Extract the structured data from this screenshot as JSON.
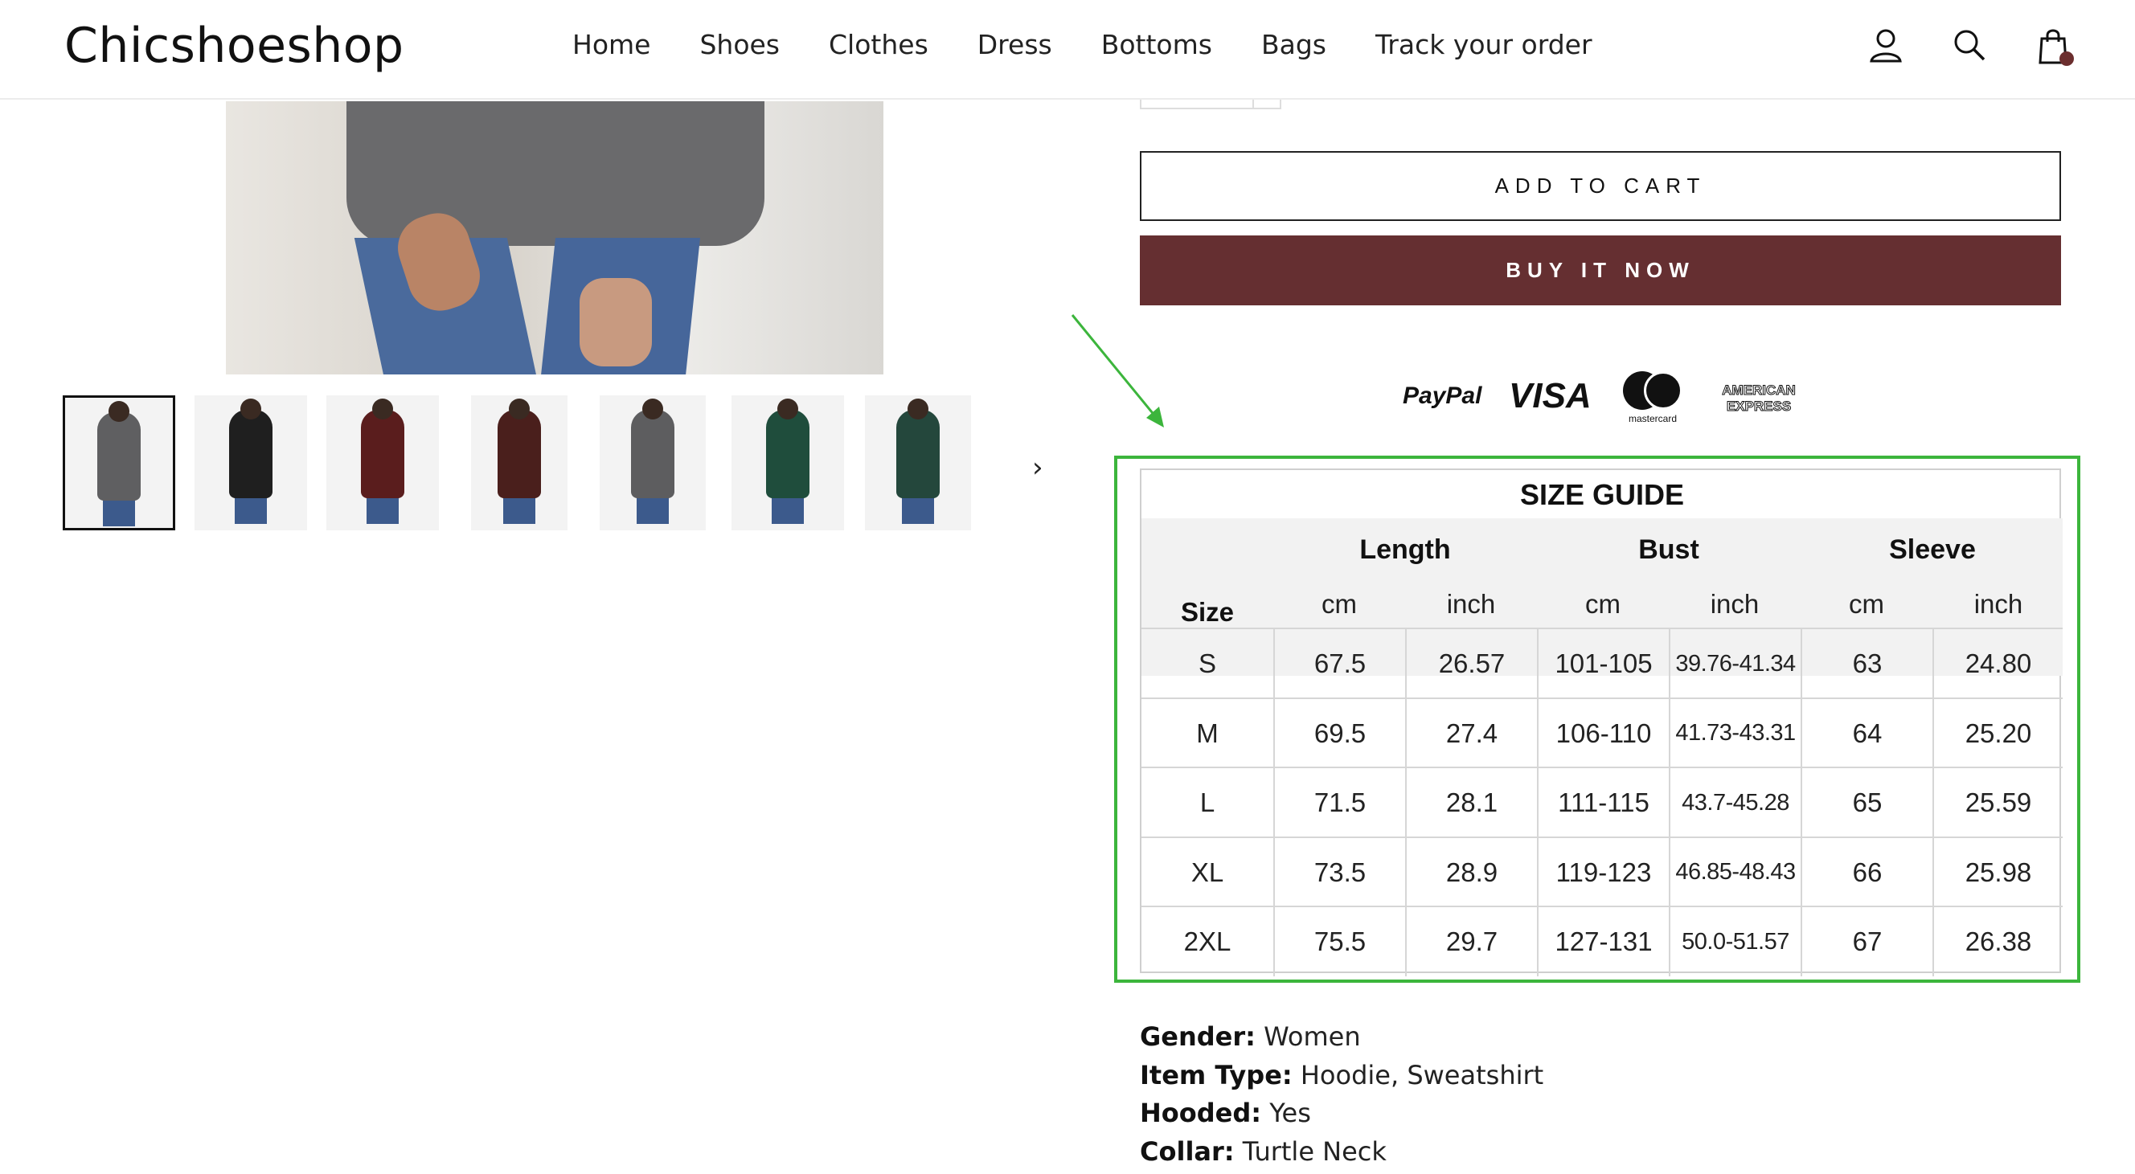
{
  "header": {
    "logo": "Chicshoeshop",
    "nav": [
      "Home",
      "Shoes",
      "Clothes",
      "Dress",
      "Bottoms",
      "Bags",
      "Track your order"
    ],
    "icons": [
      "user-icon",
      "search-icon",
      "cart-icon"
    ]
  },
  "gallery": {
    "thumbnail_count": 7,
    "selected_index": 0,
    "thumbnail_colors": [
      "#5f5f61",
      "#1f1f1f",
      "#5a1d1d",
      "#4a1f1c",
      "#5d5d5f",
      "#1f4d3c",
      "#24473c"
    ]
  },
  "product": {
    "add_to_cart": "ADD TO CART",
    "buy_now": "BUY IT NOW",
    "buy_color": "#652f31"
  },
  "payments": {
    "paypal": "PayPal",
    "visa": "VISA",
    "mastercard": "mastercard",
    "amex_line1": "AMERICAN",
    "amex_line2": "EXPRESS"
  },
  "annotation": {
    "color": "#3cb53c"
  },
  "size_guide": {
    "title": "SIZE GUIDE",
    "size_label": "Size",
    "groups": [
      "Length",
      "Bust",
      "Sleeve"
    ],
    "units": [
      "cm",
      "inch",
      "cm",
      "inch",
      "cm",
      "inch"
    ],
    "rows": [
      [
        "S",
        "67.5",
        "26.57",
        "101-105",
        "39.76-41.34",
        "63",
        "24.80"
      ],
      [
        "M",
        "69.5",
        "27.4",
        "106-110",
        "41.73-43.31",
        "64",
        "25.20"
      ],
      [
        "L",
        "71.5",
        "28.1",
        "111-115",
        "43.7-45.28",
        "65",
        "25.59"
      ],
      [
        "XL",
        "73.5",
        "28.9",
        "119-123",
        "46.85-48.43",
        "66",
        "25.98"
      ],
      [
        "2XL",
        "75.5",
        "29.7",
        "127-131",
        "50.0-51.57",
        "67",
        "26.38"
      ]
    ]
  },
  "specs": [
    {
      "key": "Gender:",
      "value": "Women"
    },
    {
      "key": "Item Type:",
      "value": "Hoodie, Sweatshirt"
    },
    {
      "key": "Hooded:",
      "value": "Yes"
    },
    {
      "key": "Collar:",
      "value": "Turtle Neck"
    }
  ]
}
